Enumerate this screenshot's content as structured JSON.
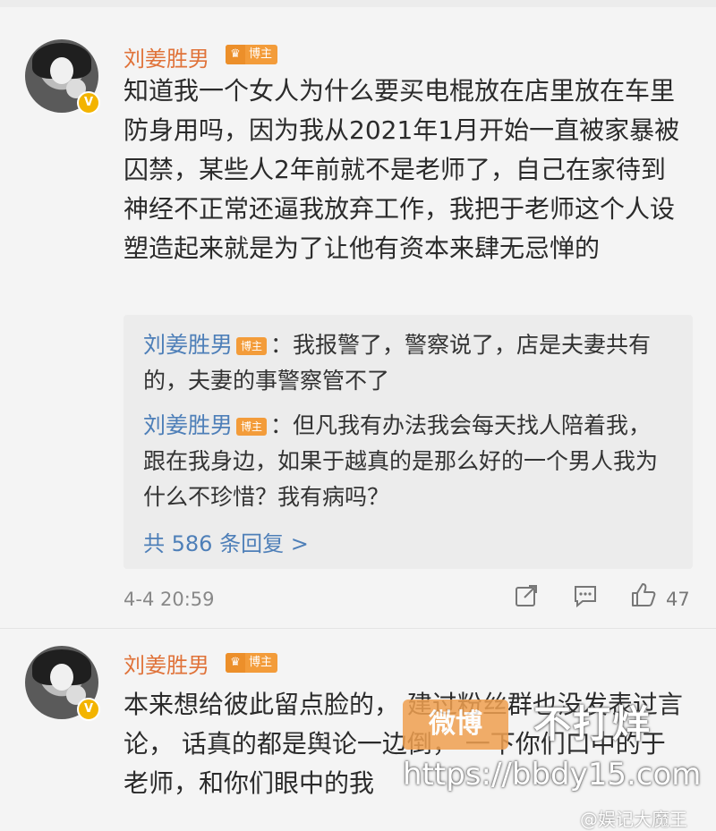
{
  "comments": [
    {
      "author": "刘姜胜男",
      "badge": "博主",
      "verified": "V",
      "text": "知道我一个女人为什么要买电棍放在店里放在车里防身用吗，因为我从2021年1月开始一直被家暴被囚禁，某些人2年前就不是老师了，自己在家待到神经不正常还逼我放弃工作，我把于老师这个人设塑造起来就是为了让他有资本来肆无忌惮的",
      "replies": [
        {
          "author": "刘姜胜男",
          "badge": "博主",
          "text": "：我报警了，警察说了，店是夫妻共有的，夫妻的事警察管不了"
        },
        {
          "author": "刘姜胜男",
          "badge": "博主",
          "text": "：但凡我有办法我会每天找人陪着我，跟在我身边，如果于越真的是那么好的一个男人我为什么不珍惜？我有病吗？"
        }
      ],
      "more_replies": "共 586 条回复 >",
      "time": "4-4 20:59",
      "likes": "47"
    },
    {
      "author": "刘姜胜男",
      "badge": "博主",
      "verified": "V",
      "text": "本来想给彼此留点脸的，                                    建过粉丝群也没发表过言论，                       话真的都是舆论一边倒，                            一下你们口中的于老师，和你们眼中的我"
    }
  ],
  "watermark": {
    "box": "微博",
    "big": "不打烊",
    "url": "https://bbdy15.com",
    "weibo": "@娱记大魔王"
  },
  "icons": [
    "share-icon",
    "comment-icon",
    "like-icon"
  ]
}
